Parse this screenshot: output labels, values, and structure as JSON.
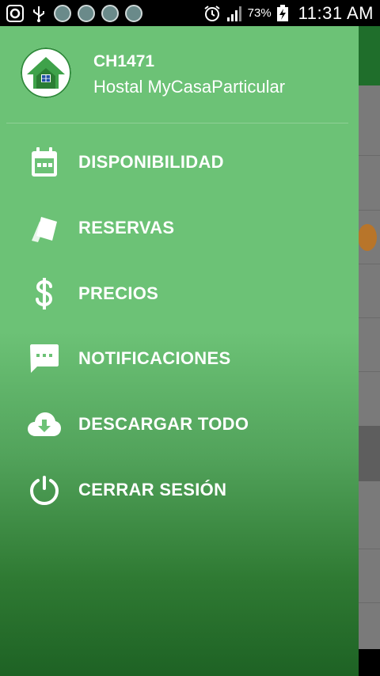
{
  "status_bar": {
    "battery_percent": "73%",
    "time": "11:31 AM"
  },
  "drawer": {
    "header": {
      "user_code": "CH1471",
      "user_name": "Hostal MyCasaParticular"
    },
    "items": [
      {
        "label": "DISPONIBILIDAD",
        "icon": "calendar-icon"
      },
      {
        "label": "RESERVAS",
        "icon": "tags-icon"
      },
      {
        "label": "PRECIOS",
        "icon": "dollar-icon"
      },
      {
        "label": "NOTIFICACIONES",
        "icon": "chat-icon"
      },
      {
        "label": "DESCARGAR TODO",
        "icon": "cloud-download-icon"
      },
      {
        "label": "CERRAR SESIÓN",
        "icon": "power-icon"
      }
    ]
  },
  "colors": {
    "drawer_green": "#6cc276",
    "drawer_dark_green": "#1e6224",
    "app_bar_green": "#1f6e2b"
  }
}
